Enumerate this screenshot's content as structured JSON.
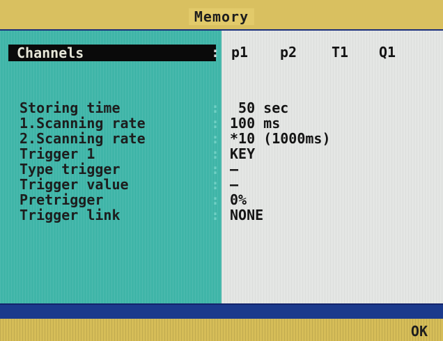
{
  "window": {
    "title": "Memory"
  },
  "channels": {
    "label": "Channels",
    "colon": ":",
    "items": [
      "p1",
      "p2",
      "T1",
      "Q1"
    ]
  },
  "settings": [
    {
      "label": "Storing time",
      "colon": ":",
      "value": " 50 sec"
    },
    {
      "label": "1.Scanning rate",
      "colon": ":",
      "value": "100 ms"
    },
    {
      "label": "2.Scanning rate",
      "colon": ":",
      "value": "*10 (1000ms)"
    },
    {
      "label": "Trigger 1",
      "colon": ":",
      "value": "KEY"
    },
    {
      "label": "Type trigger",
      "colon": ":",
      "value": "–"
    },
    {
      "label": "Trigger value",
      "colon": ":",
      "value": "–"
    },
    {
      "label": "Pretrigger",
      "colon": ":",
      "value": "0%"
    },
    {
      "label": "Trigger link",
      "colon": ":",
      "value": "NONE"
    }
  ],
  "footer": {
    "ok_label": "OK"
  },
  "colors": {
    "title_bar": "#d9c060",
    "left_panel": "#3fb5a8",
    "right_panel": "#e4e6e4",
    "bottom_bar": "#1b3a8c"
  }
}
